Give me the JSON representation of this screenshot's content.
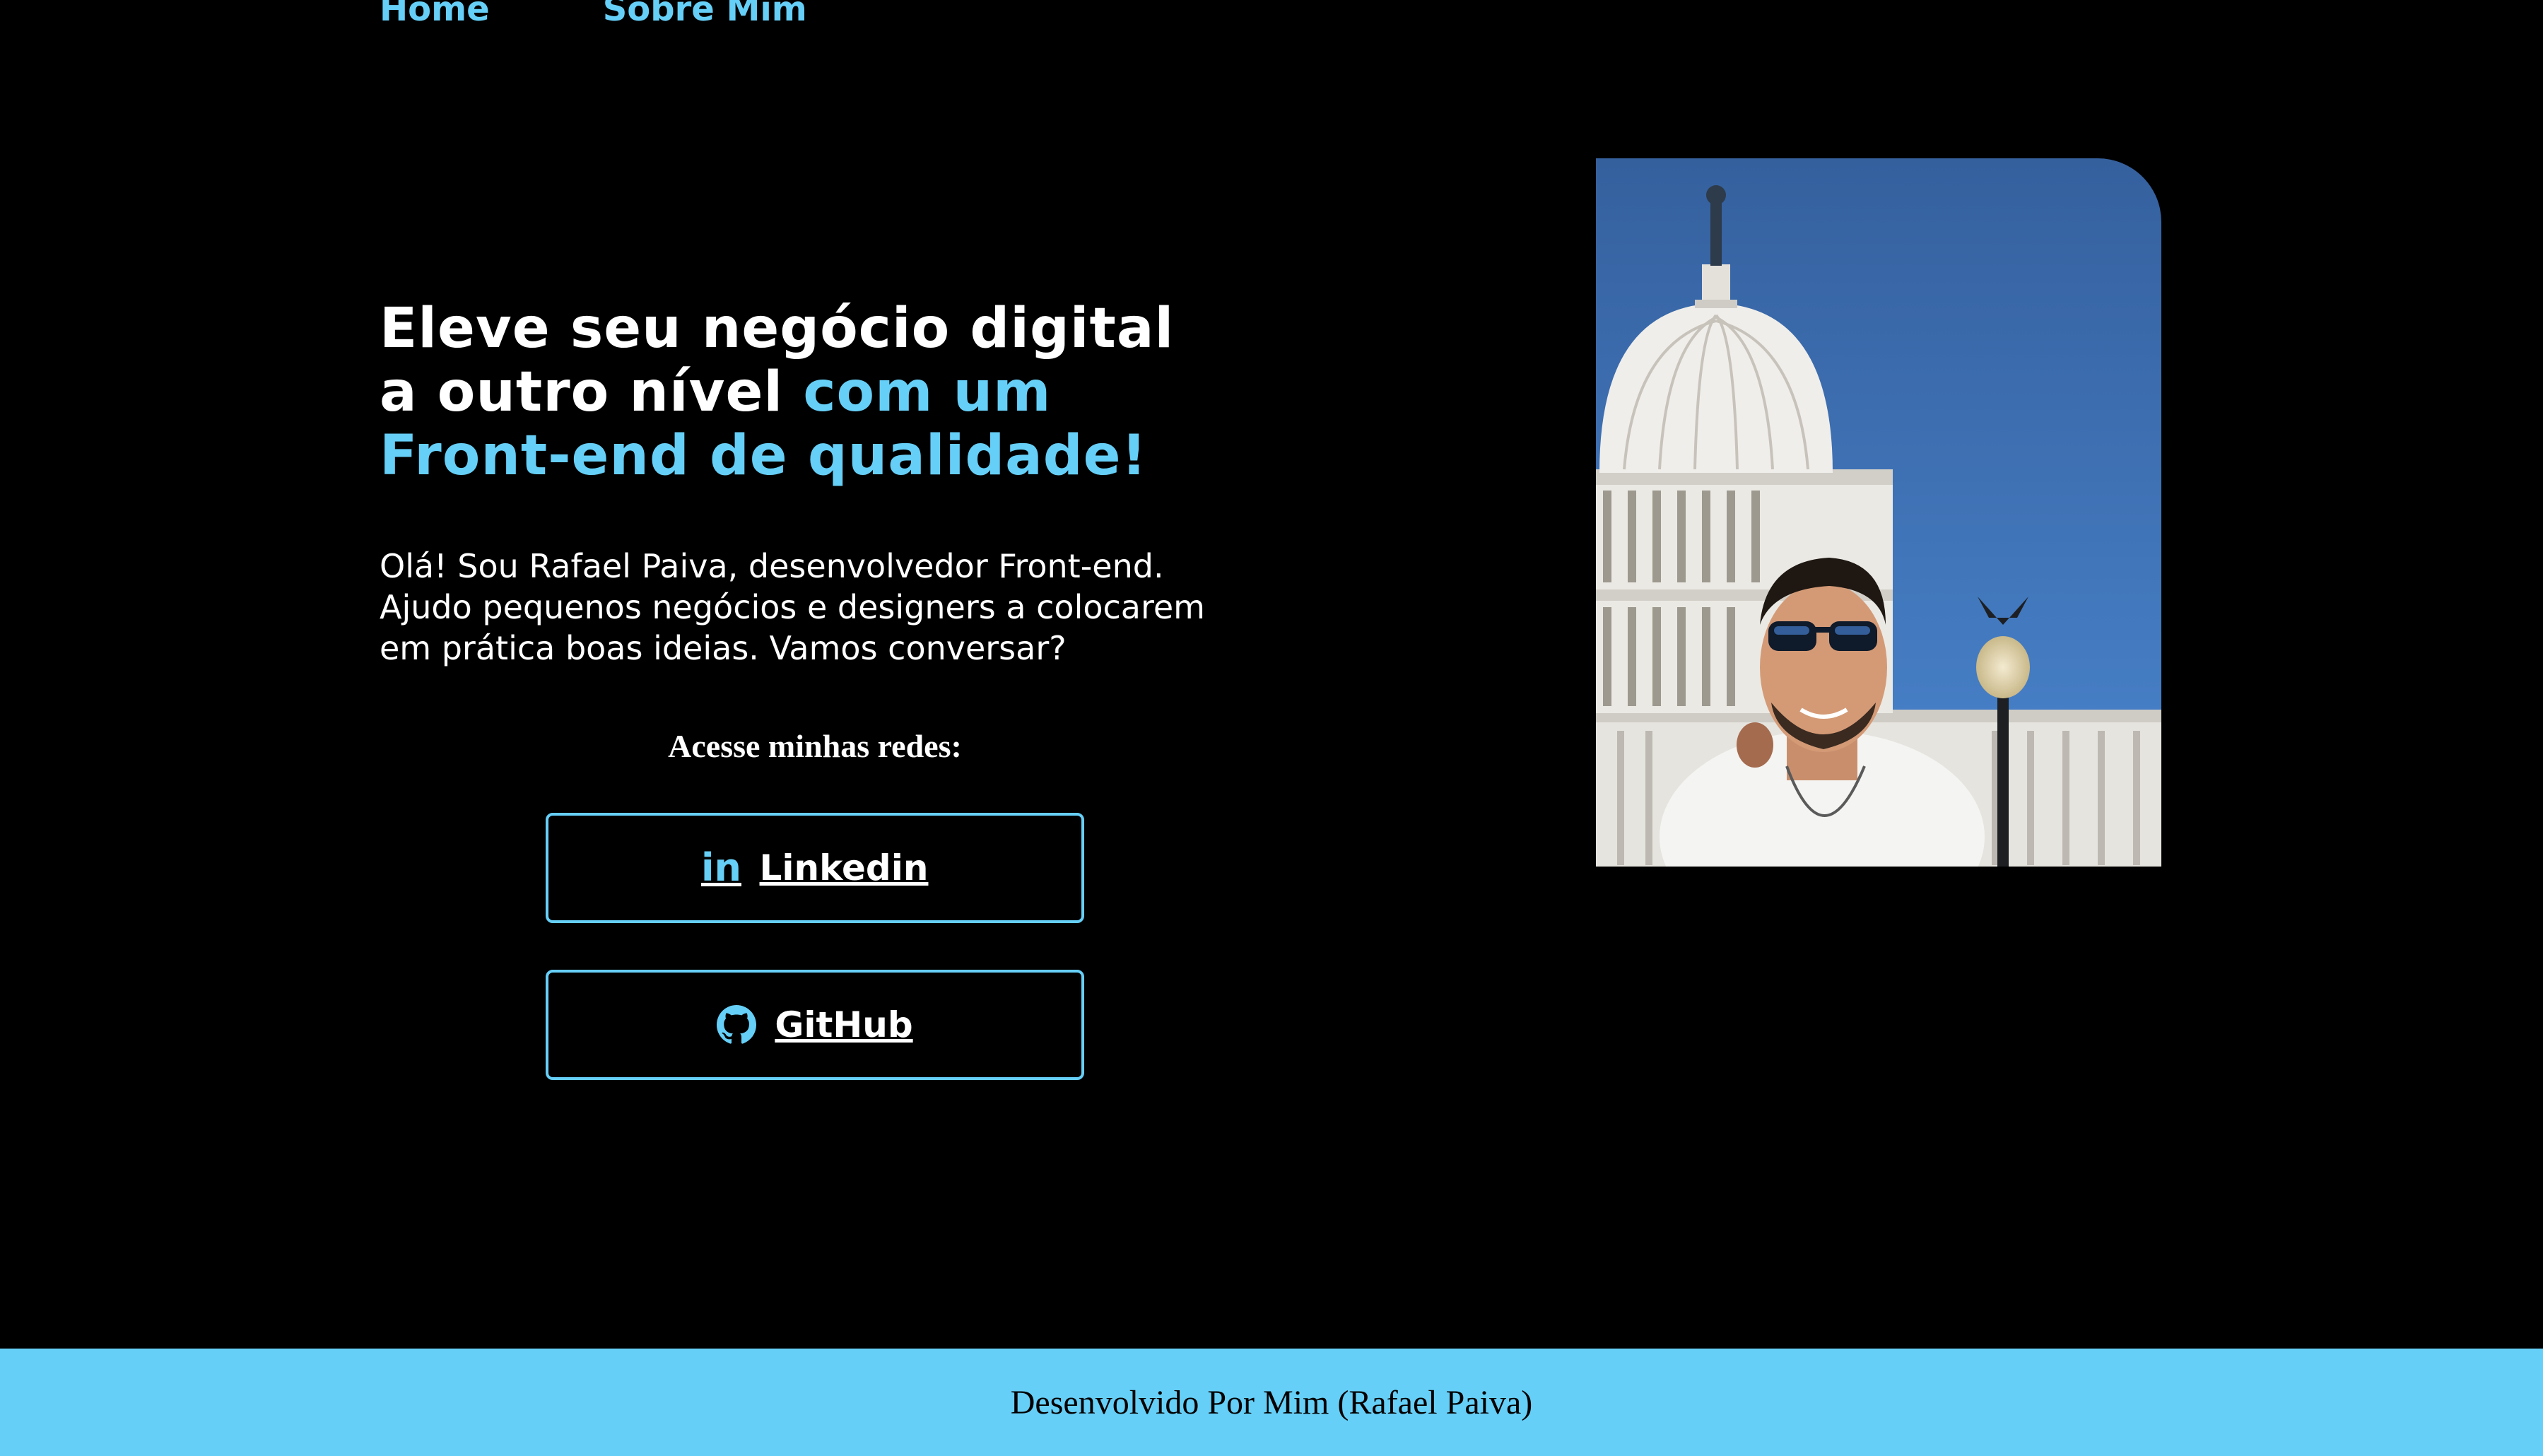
{
  "nav": {
    "home_label": "Home",
    "about_label": "Sobre Mim"
  },
  "hero": {
    "title_line1": "Eleve seu negócio digital",
    "title_line2_white": "a outro nível ",
    "title_line2_accent": "com um",
    "title_line3_accent": "Front-end de qualidade!",
    "intro_line1": "Olá! Sou Rafael Paiva, desenvolvedor Front-end.",
    "intro_line2": "Ajudo pequenos negócios e designers a colocarem",
    "intro_line3": "em prática boas ideias. Vamos conversar?"
  },
  "social": {
    "heading": "Acesse minhas redes:",
    "linkedin_label": "Linkedin",
    "linkedin_icon": "linkedin-icon",
    "github_label": "GitHub",
    "github_icon": "github-icon"
  },
  "photo": {
    "subject": "profile-photo"
  },
  "footer": {
    "text": "Desenvolvido Por Mim (Rafael Paiva)"
  },
  "colors": {
    "background": "#000000",
    "accent": "#66cff7",
    "text": "#ffffff",
    "footer_text": "#000000"
  }
}
